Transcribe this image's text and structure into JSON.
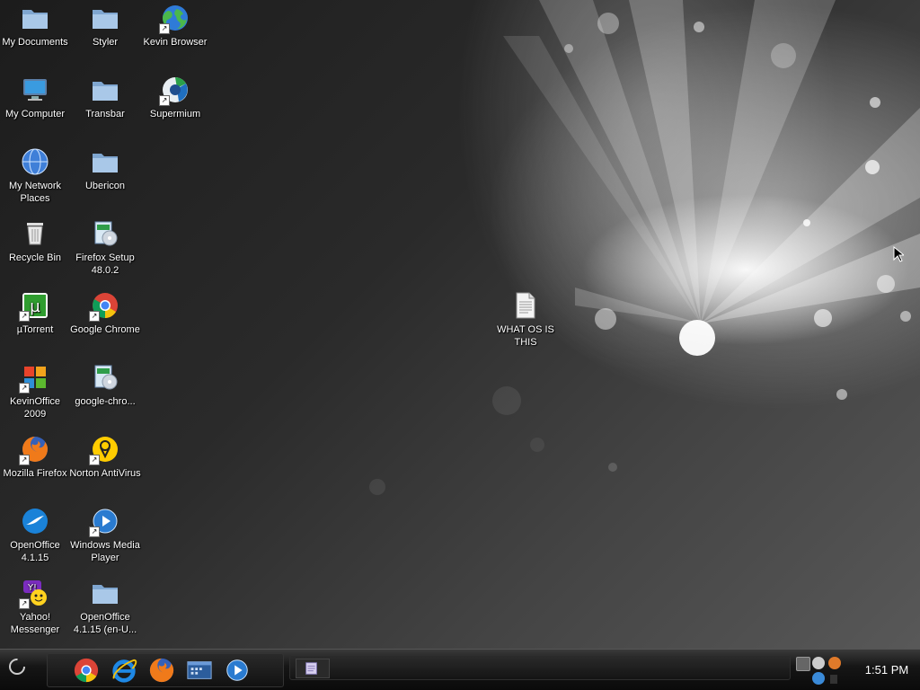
{
  "desktop": {
    "icons": [
      {
        "label": "My Documents",
        "icon": "folder-icon"
      },
      {
        "label": "My Computer",
        "icon": "computer-icon"
      },
      {
        "label": "My Network Places",
        "icon": "network-globe-icon"
      },
      {
        "label": "Recycle Bin",
        "icon": "recycle-bin-icon"
      },
      {
        "label": "µTorrent",
        "icon": "utorrent-icon"
      },
      {
        "label": "KevinOffice 2009",
        "icon": "office-icon"
      },
      {
        "label": "Mozilla Firefox",
        "icon": "firefox-icon"
      },
      {
        "label": "OpenOffice 4.1.15",
        "icon": "openoffice-icon"
      },
      {
        "label": "Yahoo! Messenger",
        "icon": "yahoo-messenger-icon"
      },
      {
        "label": "Styler",
        "icon": "folder-icon"
      },
      {
        "label": "Transbar",
        "icon": "folder-icon"
      },
      {
        "label": "Ubericon",
        "icon": "folder-icon"
      },
      {
        "label": "Firefox Setup 48.0.2",
        "icon": "installer-icon"
      },
      {
        "label": "Google Chrome",
        "icon": "chrome-icon"
      },
      {
        "label": "google-chro...",
        "icon": "installer-icon"
      },
      {
        "label": "Norton AntiVirus",
        "icon": "norton-icon"
      },
      {
        "label": "Windows Media Player",
        "icon": "media-player-icon"
      },
      {
        "label": "OpenOffice 4.1.15 (en-U...",
        "icon": "folder-icon"
      },
      {
        "label": "Kevin Browser",
        "icon": "globe-icon"
      },
      {
        "label": "Supermium",
        "icon": "supermium-icon"
      },
      {
        "label": "WHAT OS IS THIS",
        "icon": "text-document-icon"
      }
    ]
  },
  "taskbar": {
    "quick_launch": [
      {
        "name": "chrome-icon"
      },
      {
        "name": "internet-explorer-icon"
      },
      {
        "name": "firefox-icon"
      },
      {
        "name": "show-desktop-icon"
      },
      {
        "name": "media-player-icon"
      }
    ],
    "more_glyph": "›",
    "clock": "1:51 PM"
  },
  "colors": {
    "folder": "#8fb4dc",
    "taskbar": "#111111"
  }
}
